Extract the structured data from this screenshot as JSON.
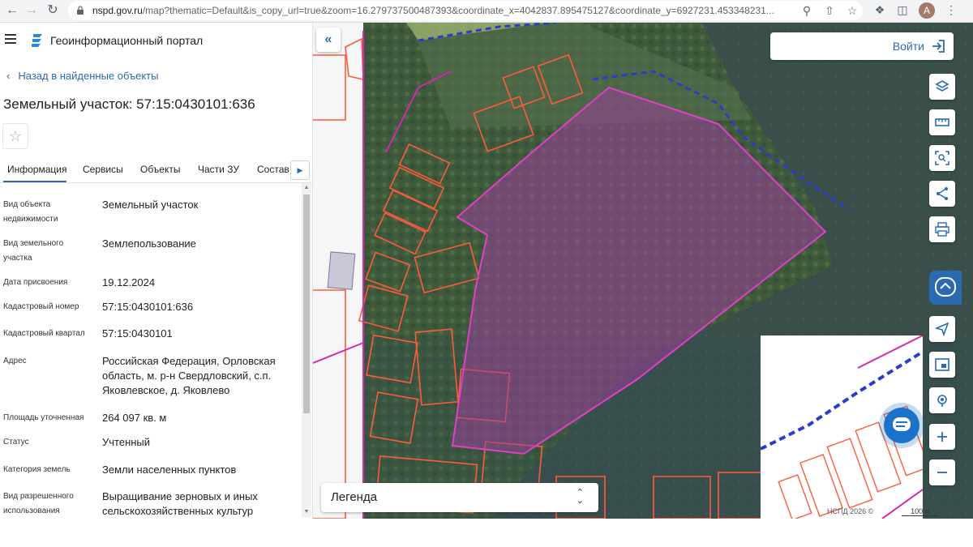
{
  "browser": {
    "url_host": "nspd.gov.ru",
    "url_rest": "/map?thematic=Default&is_copy_url=true&zoom=16.279737500487393&coordinate_x=4042837.895475127&coordinate_y=6927231.453348231...",
    "profile_initial": "A"
  },
  "sidebar": {
    "portal_title": "Геоинформационный портал",
    "back_link": "Назад в найденные объекты",
    "title": "Земельный участок: 57:15:0430101:636",
    "tabs": [
      {
        "label": "Информация"
      },
      {
        "label": "Сервисы"
      },
      {
        "label": "Объекты"
      },
      {
        "label": "Части ЗУ"
      },
      {
        "label": "Состав"
      }
    ],
    "info": [
      {
        "label": "Вид объекта недвижимости",
        "value": "Земельный участок"
      },
      {
        "label": "Вид земельного участка",
        "value": "Землепользование"
      },
      {
        "label": "Дата присвоения",
        "value": "19.12.2024"
      },
      {
        "label": "Кадастровый номер",
        "value": "57:15:0430101:636"
      },
      {
        "label": "Кадастровый квартал",
        "value": "57:15:0430101"
      },
      {
        "label": "Адрес",
        "value": "Российская Федерация, Орловская область, м. р-н Свердловский, с.п. Яковлевское, д. Яковлево"
      },
      {
        "label": "Площадь уточненная",
        "value": "264 097 кв. м"
      },
      {
        "label": "Статус",
        "value": "Учтенный"
      },
      {
        "label": "Категория земель",
        "value": "Земли населенных пунктов"
      },
      {
        "label": "Вид разрешенного использования",
        "value": "Выращивание зерновых и иных сельскохозяйственных культур"
      }
    ]
  },
  "map": {
    "login_label": "Войти",
    "legend_label": "Легенда",
    "attribution": "НСПД 2026 ©",
    "scale_label": "100 м",
    "colors": {
      "accent": "#2a6ab0",
      "parcel_fill": "#9b3f9a",
      "parcel_outline": "#e040c8",
      "cadastre_lines": "#ff5a3c",
      "boundary_dashed": "#2a3ccc"
    }
  }
}
